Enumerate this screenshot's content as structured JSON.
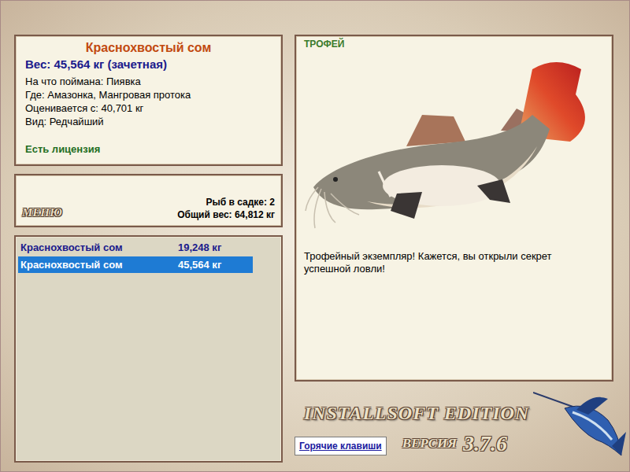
{
  "fish_card": {
    "name": "Краснохвостый сом",
    "weight": "Вес: 45,564 кг (зачетная)",
    "details": [
      "На что поймана: Пиявка",
      "Где: Амазонка, Мангровая протока",
      "Оценивается с: 40,701 кг",
      "Вид: Редчайший"
    ],
    "license": "Есть лицензия"
  },
  "menu": {
    "label": "МЕНЮ",
    "count": "Рыб в садке: 2",
    "total": "Общий вес: 64,812 кг"
  },
  "catch_list": [
    {
      "name": "Краснохвостый сом",
      "weight": "19,248 кг",
      "selected": false
    },
    {
      "name": "Краснохвостый сом",
      "weight": "45,564 кг",
      "selected": true
    }
  ],
  "trophy": {
    "badge": "ТРОФЕЙ",
    "message": "Трофейный экземпляр! Кажется, вы открыли секрет успешной ловли!"
  },
  "footer": {
    "edition": "INSTALLSOFT EDITION",
    "version_label": "ВЕРСИЯ",
    "version": "3.7.6",
    "hotkeys_button": "Горячие клавиши"
  }
}
